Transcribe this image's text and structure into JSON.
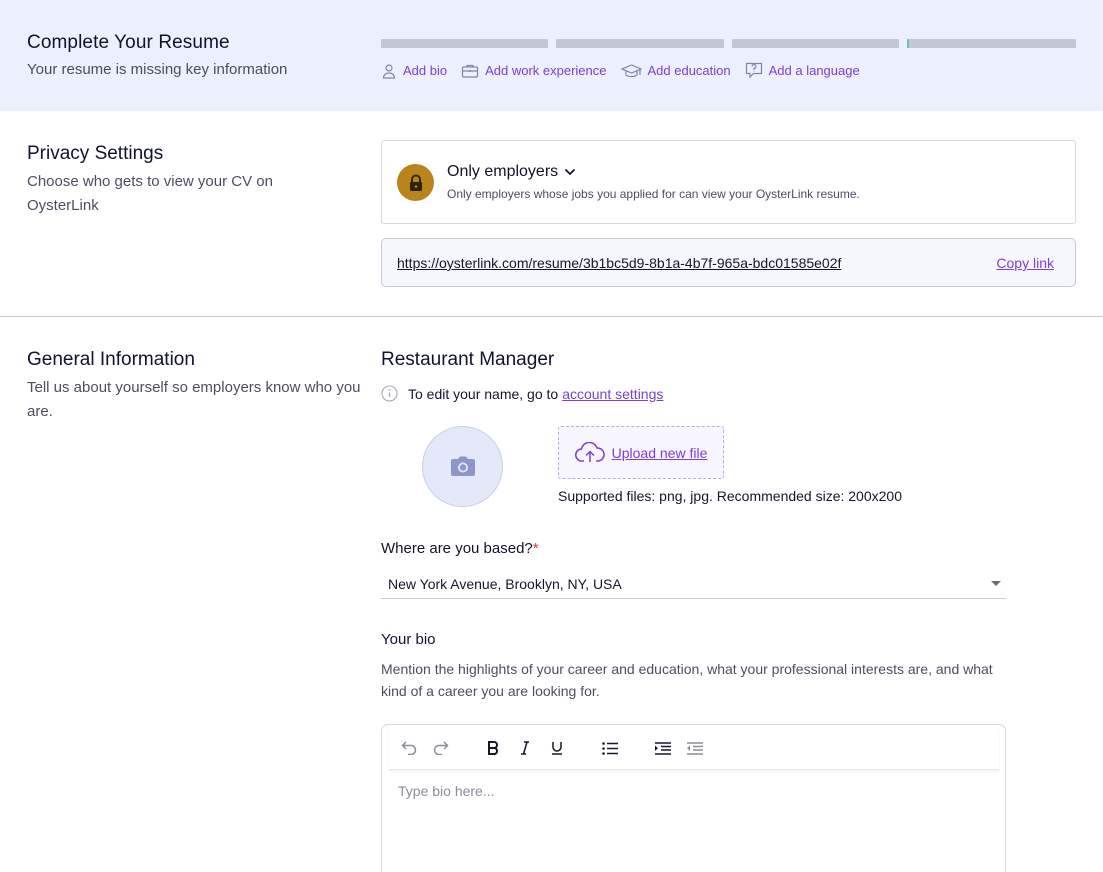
{
  "banner": {
    "title": "Complete Your Resume",
    "subtitle": "Your resume is missing key information",
    "progress_segments": 4,
    "actions": [
      {
        "label": "Add bio",
        "icon": "person-icon"
      },
      {
        "label": "Add work experience",
        "icon": "briefcase-icon"
      },
      {
        "label": "Add education",
        "icon": "graduation-cap-icon"
      },
      {
        "label": "Add a language",
        "icon": "speech-bubble-icon"
      }
    ]
  },
  "privacy": {
    "title": "Privacy Settings",
    "description": "Choose who gets to view your CV on OysterLink",
    "selected": "Only employers",
    "note": "Only employers whose jobs you applied for can view your OysterLink resume.",
    "url": "https://oysterlink.com/resume/3b1bc5d9-8b1a-4b7f-965a-bdc01585e02f",
    "copy_label": "Copy link"
  },
  "general": {
    "title": "General Information",
    "description": "Tell us about yourself so employers know who you are.",
    "job_title": "Restaurant Manager",
    "name_note_prefix": "To edit your name, go to",
    "name_note_link": "account settings",
    "upload_label": "Upload new file",
    "supported_files": "Supported files: png, jpg. Recommended size: 200x200",
    "location_label": "Where are you based?",
    "location_required": "*",
    "location_value": "New York Avenue, Brooklyn, NY, USA",
    "bio_label": "Your bio",
    "bio_description": "Mention the highlights of your career and education, what your professional interests are, and what kind of a career you are looking for.",
    "bio_placeholder": "Type bio here..."
  },
  "colors": {
    "accent": "#7a3fd6",
    "banner_bg": "#eceffc",
    "lock_bg": "#b9841b"
  }
}
